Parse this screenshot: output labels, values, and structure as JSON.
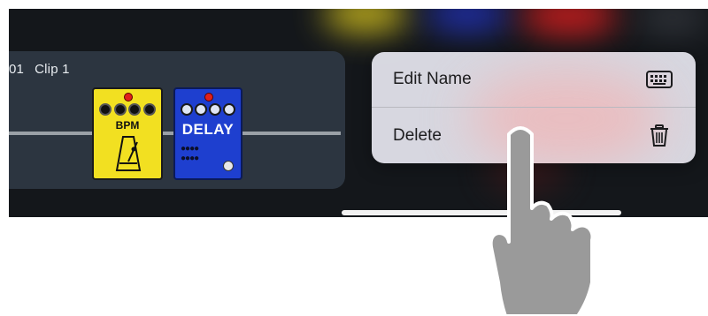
{
  "clip": {
    "sequence": "01",
    "name": "Clip 1"
  },
  "pedals": [
    {
      "label": "BPM",
      "color": "#f2e021",
      "icon": "metronome-icon"
    },
    {
      "label": "DELAY",
      "color": "#1e3fcf",
      "icon": "delay-knobs-icon"
    }
  ],
  "context_menu": {
    "items": [
      {
        "label": "Edit Name",
        "icon": "keyboard-icon"
      },
      {
        "label": "Delete",
        "icon": "trash-icon"
      }
    ]
  },
  "overlay": {
    "gesture": "tap-hand-icon"
  },
  "colors": {
    "background": "#14171b",
    "clip": "#2c3540",
    "menu": "#e0e0e8",
    "accent_red": "#d91d1d",
    "accent_blue": "#2233c6",
    "accent_yellow": "#d9c51d"
  }
}
